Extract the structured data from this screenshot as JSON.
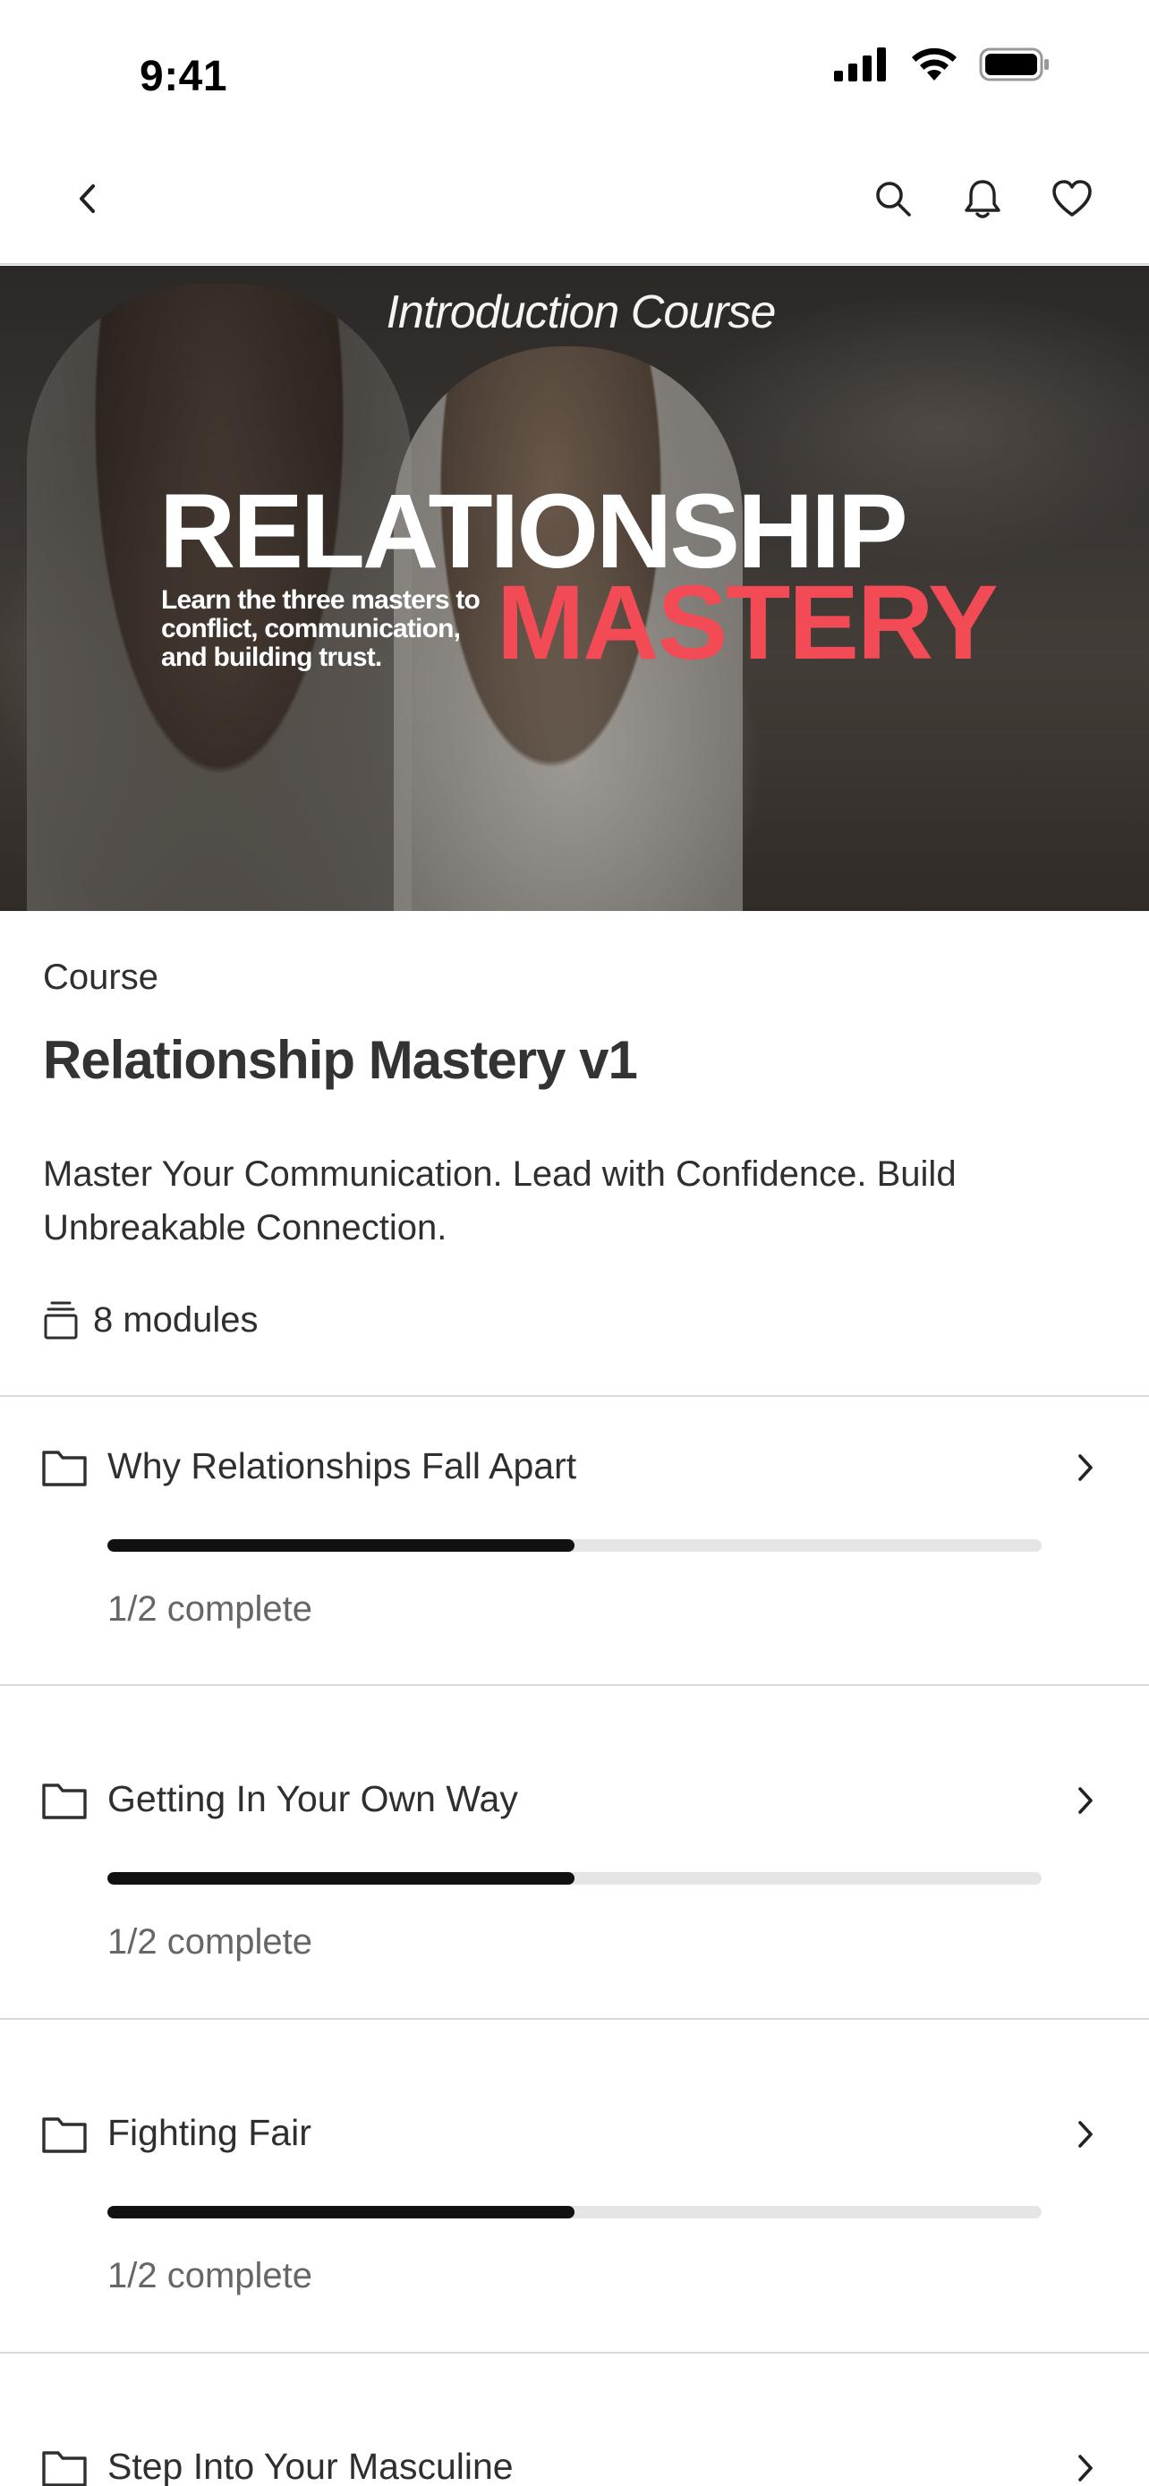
{
  "status_bar": {
    "time": "9:41"
  },
  "nav": {
    "back_icon": "chevron-left-icon",
    "actions": [
      "search-icon",
      "bell-icon",
      "heart-icon"
    ]
  },
  "hero": {
    "subtitle": "Introduction Course",
    "title_line1": "RELATIONSHIP",
    "title_line2": "MASTERY",
    "tagline": "Learn the three masters to conflict, communication, and building trust.",
    "accent_color": "#f24b55"
  },
  "course": {
    "label": "Course",
    "title": "Relationship Mastery v1",
    "description": "Master Your Communication. Lead with Confidence. Build Unbreakable Connection.",
    "modules_count": "8 modules",
    "modules_icon": "stack-icon"
  },
  "modules": [
    {
      "title": "Why Relationships Fall Apart",
      "progress": 0.5,
      "status": "1/2 complete"
    },
    {
      "title": "Getting In Your Own Way",
      "progress": 0.5,
      "status": "1/2 complete"
    },
    {
      "title": "Fighting Fair",
      "progress": 0.5,
      "status": "1/2 complete"
    },
    {
      "title": "Step Into Your Masculine"
    }
  ]
}
